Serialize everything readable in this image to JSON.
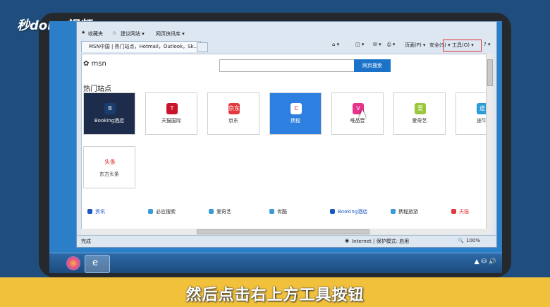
{
  "brand": "秒dong视频",
  "subtitle": "然后点击右上方工具按钮",
  "ie": {
    "favorites": "收藏夹",
    "fav_items": [
      "建议网站 ▾",
      "网页快讯库 ▾"
    ],
    "tab_title": "MSN中国 | 热门站点，Hotmail，Outlook，Sk...",
    "cmd": {
      "page": "页面(P) ▾",
      "safety": "安全(S) ▾",
      "tools": "工具(O) ▾"
    },
    "status": {
      "done": "完成",
      "zone": "Internet | 保护模式: 启用",
      "zoom": "100%"
    }
  },
  "msn": {
    "logo": "msn",
    "search_button": "网页搜索",
    "section": "热门站点",
    "tiles": [
      {
        "label": "Booking酒店",
        "icon": "B",
        "bg": "#1c2c4a",
        "color": "#ffffff",
        "ic": "#1a3c6e"
      },
      {
        "label": "天猫国际",
        "icon": "T",
        "bg": "#ffffff",
        "color": "#333333",
        "ic": "#c9132b"
      },
      {
        "label": "京东",
        "icon": "京东",
        "bg": "#ffffff",
        "color": "#333333",
        "ic": "#e4393c"
      },
      {
        "label": "携程",
        "icon": "C",
        "bg": "#2d7fe0",
        "color": "#ffffff",
        "ic": "#ffffff"
      },
      {
        "label": "唯品会",
        "icon": "V",
        "bg": "#ffffff",
        "color": "#333333",
        "ic": "#e8338b"
      },
      {
        "label": "爱奇艺",
        "icon": "爱",
        "bg": "#ffffff",
        "color": "#333333",
        "ic": "#9bc83a"
      },
      {
        "label": "途牛",
        "icon": "途",
        "bg": "#ffffff",
        "color": "#333333",
        "ic": "#2a9bd8"
      },
      {
        "label": "东方头条",
        "icon": "头条",
        "bg": "#ffffff",
        "color": "#333333",
        "ic": "#ffffff"
      }
    ],
    "links": [
      {
        "label": "资讯",
        "color": "#1a56c4"
      },
      {
        "label": "必应搜索",
        "color": "#333333"
      },
      {
        "label": "爱奇艺",
        "color": "#333333"
      },
      {
        "label": "优酷",
        "color": "#333333"
      },
      {
        "label": "Booking酒店",
        "color": "#1a56c4"
      },
      {
        "label": "携程旅游",
        "color": "#333333"
      },
      {
        "label": "天猫",
        "color": "#e4393c"
      }
    ]
  }
}
